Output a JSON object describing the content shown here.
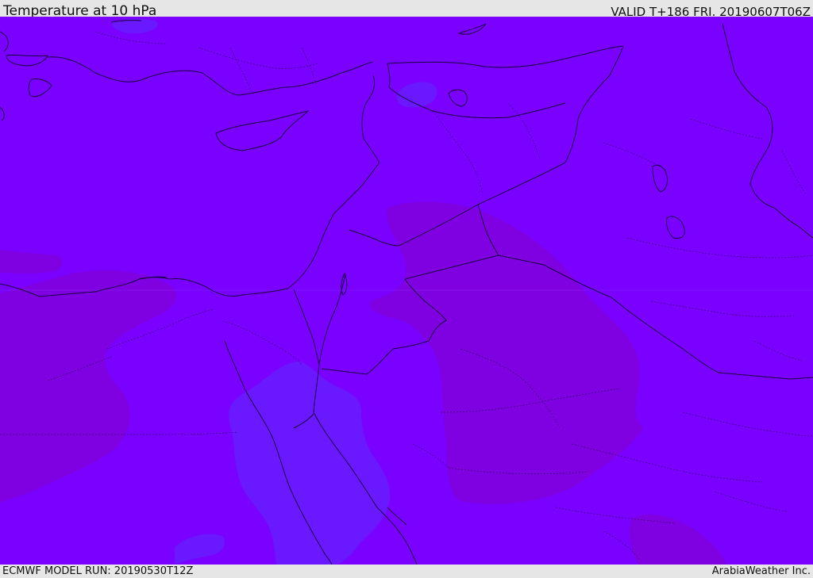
{
  "header": {
    "title": "Temperature at 10 hPa",
    "valid": "VALID T+186 FRI. 20190607T06Z"
  },
  "footer": {
    "model_run": "ECMWF MODEL RUN: 20190530T12Z",
    "credit": "ArabiaWeather Inc."
  },
  "map": {
    "colors": {
      "base_fill": "#7a00ff",
      "warm_fill": "#7f00e0",
      "cool_fill": "#6a18ff",
      "coast_line": "#1a0040",
      "border_line": "#1a0040"
    }
  }
}
